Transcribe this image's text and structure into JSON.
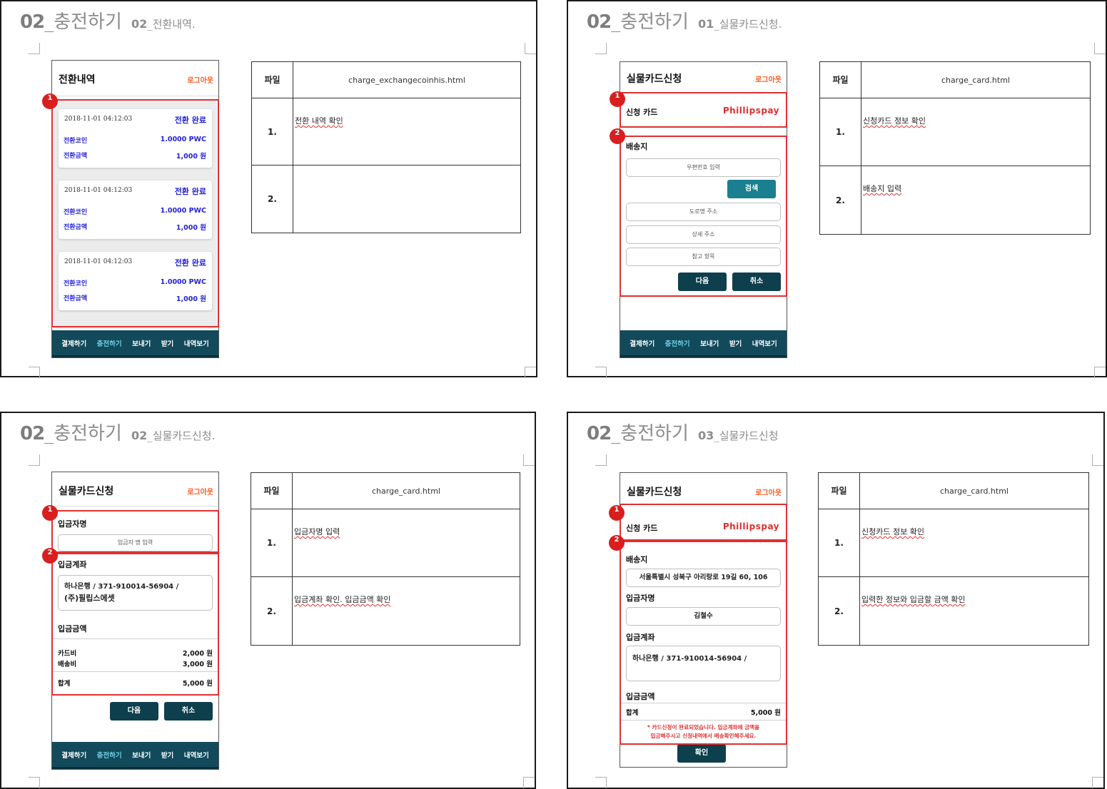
{
  "colors": {
    "accent_red": "#e03030",
    "nav_bg": "#124a5b",
    "nav_active": "#6fd0e6",
    "logout": "#ff5a1f",
    "link_blue": "#2323d6",
    "button_dark": "#0e3f4d",
    "button_teal": "#1a7f8e"
  },
  "nav_items": [
    "결제하기",
    "충전하기",
    "보내기",
    "받기",
    "내역보기"
  ],
  "logout_label": "로그아웃",
  "file_header": "파일",
  "sheets": [
    {
      "title_num": "02",
      "title_main": "_충전하기",
      "sub_num": "02",
      "sub_text": "_전환내역.",
      "phone_title": "전환내역",
      "markers": [
        "1"
      ],
      "cards": [
        {
          "date": "2018-11-01 04:12:03",
          "status": "전환 완료",
          "coin_label": "전환코인",
          "coin_value": "1.0000 PWC",
          "amount_label": "전환금액",
          "amount_value": "1,000 원"
        },
        {
          "date": "2018-11-01 04:12:03",
          "status": "전환 완료",
          "coin_label": "전환코인",
          "coin_value": "1.0000 PWC",
          "amount_label": "전환금액",
          "amount_value": "1,000 원"
        },
        {
          "date": "2018-11-01 04:12:03",
          "status": "전환 완료",
          "coin_label": "전환코인",
          "coin_value": "1.0000 PWC",
          "amount_label": "전환금액",
          "amount_value": "1,000 원"
        }
      ],
      "file_name": "charge_exchangecoinhis.html",
      "rows": [
        {
          "num": "1.",
          "desc": "전환 내역 확인"
        },
        {
          "num": "2.",
          "desc": ""
        }
      ]
    },
    {
      "title_num": "02",
      "title_main": "_충전하기",
      "sub_num": "01",
      "sub_text": "_실물카드신청.",
      "phone_title": "실물카드신청",
      "markers": [
        "1",
        "2"
      ],
      "card_label": "신청 카드",
      "card_brand": "Phillipspay",
      "ship_label": "배송지",
      "zip_placeholder": "우편번호 입력",
      "search_button": "검색",
      "road_placeholder": "도로명 주소",
      "detail_placeholder": "상세 주소",
      "ref_placeholder": "참고 항목",
      "next_button": "다음",
      "cancel_button": "취소",
      "file_name": "charge_card.html",
      "rows": [
        {
          "num": "1.",
          "desc": "신청카드 정보 확인"
        },
        {
          "num": "2.",
          "desc": "배송지 입력"
        }
      ]
    },
    {
      "title_num": "02",
      "title_main": "_충전하기",
      "sub_num": "02",
      "sub_text": "_실물카드신청.",
      "phone_title": "실물카드신청",
      "markers": [
        "1",
        "2"
      ],
      "depositor_label": "입금자명",
      "depositor_placeholder": "입금자 명 입력",
      "account_label": "입금계좌",
      "account_line1": "하나은행 / 371-910014-56904 /",
      "account_line2": "(주)필립스에셋",
      "amount_label": "입금금액",
      "card_fee_label": "카드비",
      "card_fee_value": "2,000 원",
      "ship_fee_label": "배송비",
      "ship_fee_value": "3,000 원",
      "total_label": "합계",
      "total_value": "5,000 원",
      "next_button": "다음",
      "cancel_button": "취소",
      "file_name": "charge_card.html",
      "rows": [
        {
          "num": "1.",
          "desc": "입금자명 입력"
        },
        {
          "num": "2.",
          "desc": "입금계좌 확인. 입금금액 확인"
        }
      ]
    },
    {
      "title_num": "02",
      "title_main": "_충전하기",
      "sub_num": "03",
      "sub_text": "_실물카드신청",
      "phone_title": "실물카드신청",
      "markers": [
        "1",
        "2"
      ],
      "card_label": "신청 카드",
      "card_brand": "Phillipspay",
      "ship_label": "배송지",
      "address_value": "서울특별시 성북구 아리랑로 19길 60, 106",
      "depositor_label": "입금자명",
      "depositor_value": "김철수",
      "account_label": "입금계좌",
      "account_value": "하나은행 / 371-910014-56904 /",
      "amount_label": "입금금액",
      "total_label": "합계",
      "total_value": "5,000 원",
      "notice_line1": "* 카드신청이 완료되었습니다. 입금계좌에 금액을",
      "notice_line2": "입금해주시고 신청내역에서 배송확인해주세요.",
      "confirm_button": "확인",
      "file_name": "charge_card.html",
      "rows": [
        {
          "num": "1.",
          "desc": "신청카드 정보 확인"
        },
        {
          "num": "2.",
          "desc": "입력한 정보와 입금할 금액 확인"
        }
      ]
    }
  ]
}
